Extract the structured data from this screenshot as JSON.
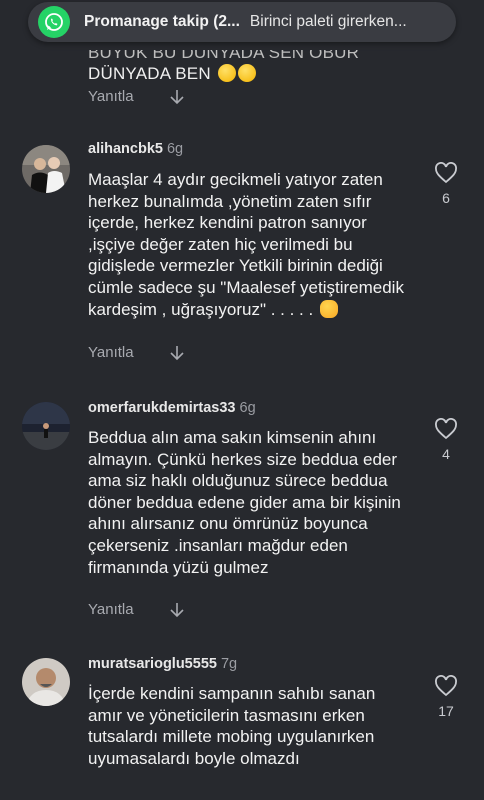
{
  "notification": {
    "app": "WhatsApp",
    "title": "Promanage takip (2...",
    "message": "Birinci paleti girerken..."
  },
  "partial_comment": {
    "line1": "BUYUK BU DUNYADA SEN OBUR",
    "line2": "DÜNYADA BEN",
    "reply_label": "Yanıtla"
  },
  "comments": [
    {
      "username": "alihancbk5",
      "time": "6g",
      "text": "Maaşlar 4 aydır gecikmeli yatıyor zaten herkez bunalımda ,yönetim zaten sıfır içerde, herkez kendini patron sanıyor ,işçiye değer zaten hiç verilmedi bu gidişlede vermezler Yetkili birinin dediği cümle sadece şu \"Maalesef yetiştiremedik kardeşim , uğraşıyoruz\" . . . . .",
      "likes": "6",
      "reply_label": "Yanıtla"
    },
    {
      "username": "omerfarukdemirtas33",
      "time": "6g",
      "text": "Beddua alın ama sakın kimsenin ahını almayın. Çünkü herkes size beddua eder ama siz haklı olduğunuz sürece beddua döner beddua edene gider ama bir kişinin ahını alırsanız onu ömrünüz boyunca çekerseniz .insanları mağdur eden firmanında yüzü gulmez",
      "likes": "4",
      "reply_label": "Yanıtla"
    },
    {
      "username": "muratsarioglu5555",
      "time": "7g",
      "text": "İçerde kendini sampanın sahıbı sanan amır ve yöneticilerin tasmasını erken tutsalardı millete mobing uygulanırken uyumasalardı boyle olmazdı",
      "likes": "17"
    }
  ]
}
